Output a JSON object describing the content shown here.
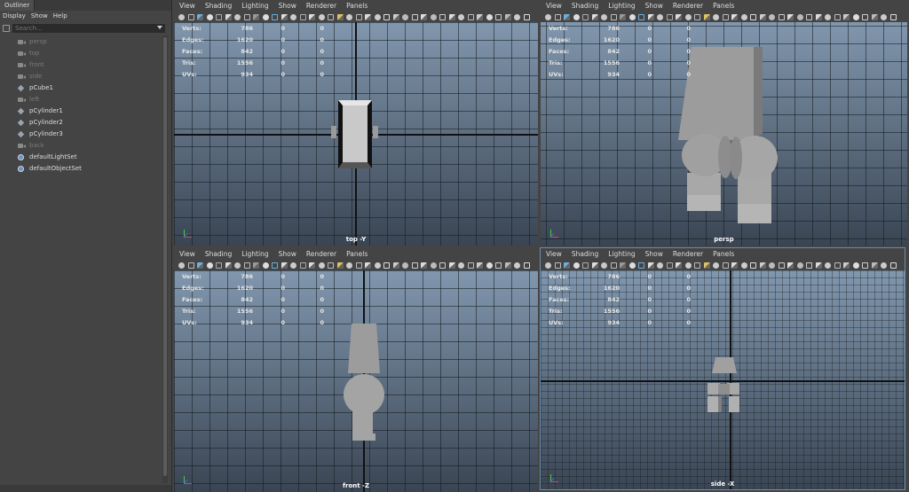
{
  "outliner": {
    "tab": "Outliner",
    "menu": [
      "Display",
      "Show",
      "Help"
    ],
    "search_placeholder": "Search...",
    "items": [
      {
        "label": "persp",
        "type": "camera",
        "dim": true
      },
      {
        "label": "top",
        "type": "camera",
        "dim": true
      },
      {
        "label": "front",
        "type": "camera",
        "dim": true
      },
      {
        "label": "side",
        "type": "camera",
        "dim": true
      },
      {
        "label": "pCube1",
        "type": "mesh",
        "dim": false
      },
      {
        "label": "left",
        "type": "camera",
        "dim": true
      },
      {
        "label": "pCylinder1",
        "type": "mesh",
        "dim": false
      },
      {
        "label": "pCylinder2",
        "type": "mesh",
        "dim": false
      },
      {
        "label": "pCylinder3",
        "type": "mesh",
        "dim": false
      },
      {
        "label": "back",
        "type": "camera",
        "dim": true
      },
      {
        "label": "defaultLightSet",
        "type": "set",
        "dim": false
      },
      {
        "label": "defaultObjectSet",
        "type": "set",
        "dim": false
      }
    ]
  },
  "viewport_menu": [
    "View",
    "Shading",
    "Lighting",
    "Show",
    "Renderer",
    "Panels"
  ],
  "stats": [
    {
      "label": "Verts:",
      "v1": "786",
      "v2": "0",
      "v3": "0"
    },
    {
      "label": "Edges:",
      "v1": "1620",
      "v2": "0",
      "v3": "0"
    },
    {
      "label": "Faces:",
      "v1": "842",
      "v2": "0",
      "v3": "0"
    },
    {
      "label": "Tris:",
      "v1": "1556",
      "v2": "0",
      "v3": "0"
    },
    {
      "label": "UVs:",
      "v1": "934",
      "v2": "0",
      "v3": "0"
    }
  ],
  "viewports": {
    "top": {
      "label": "top -Y"
    },
    "persp": {
      "label": "persp"
    },
    "front": {
      "label": "front -Z"
    },
    "side": {
      "label": "side -X"
    }
  },
  "colors": {
    "accent": "#5aa0d8",
    "viewport_top": "#8197ae",
    "viewport_bottom": "#3a4553"
  }
}
